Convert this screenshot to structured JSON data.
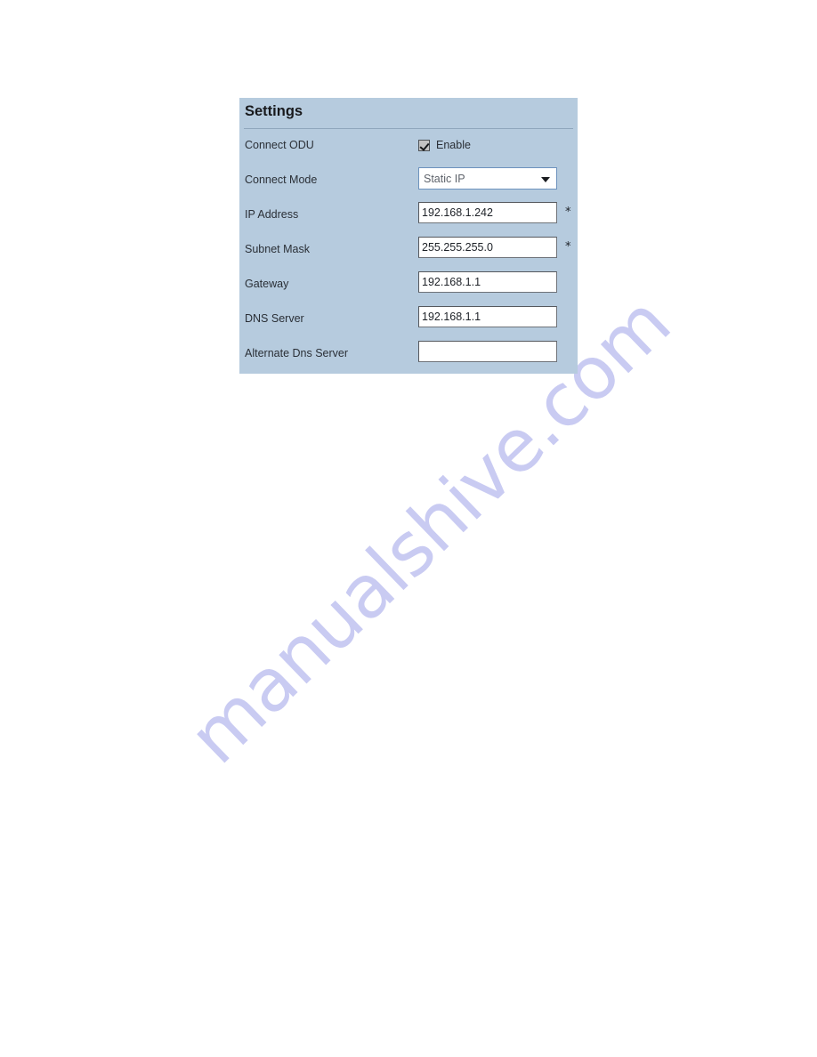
{
  "watermark": {
    "text": "manualshive.com",
    "color": "#c9cbf2"
  },
  "panel": {
    "title": "Settings",
    "background_color": "#b6cbde",
    "rows": [
      {
        "label": "Connect ODU",
        "type": "checkbox",
        "checkbox_label": "Enable",
        "checked": true,
        "required": false
      },
      {
        "label": "Connect Mode",
        "type": "select",
        "value": "Static IP",
        "required": false
      },
      {
        "label": "IP Address",
        "type": "text",
        "value": "192.168.1.242",
        "placeholder": "",
        "required": true
      },
      {
        "label": "Subnet Mask",
        "type": "text",
        "value": "255.255.255.0",
        "placeholder": "",
        "required": true
      },
      {
        "label": "Gateway",
        "type": "text",
        "value": "192.168.1.1",
        "placeholder": "",
        "required": false
      },
      {
        "label": "DNS Server",
        "type": "text",
        "value": "192.168.1.1",
        "placeholder": "",
        "required": false
      },
      {
        "label": "Alternate Dns Server",
        "type": "text",
        "value": "",
        "placeholder": "",
        "required": false
      }
    ],
    "required_marker": "*"
  }
}
